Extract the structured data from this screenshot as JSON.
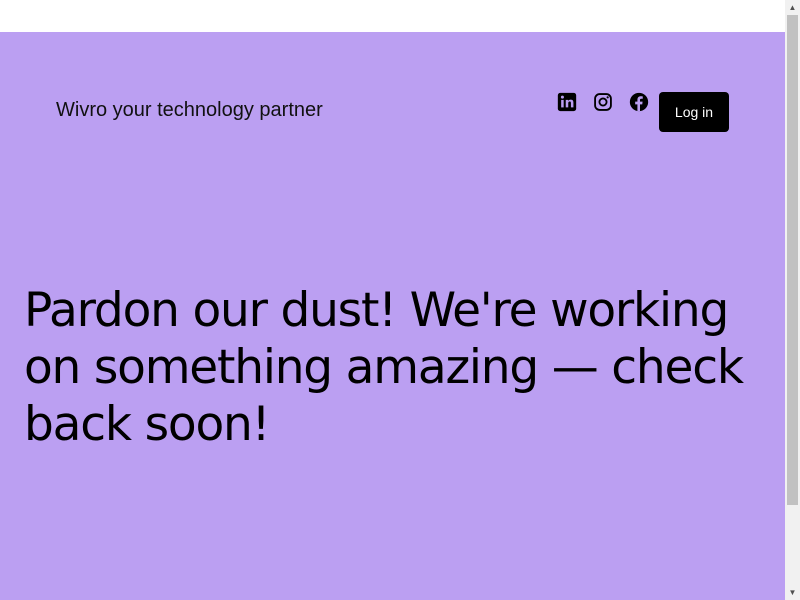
{
  "header": {
    "site_title": "Wivro your technology partner",
    "social_icons": [
      "linkedin-icon",
      "instagram-icon",
      "facebook-icon"
    ],
    "login_label": "Log in"
  },
  "hero": {
    "heading": "Pardon our dust! We're working on something amazing — check back soon!"
  },
  "colors": {
    "page_background": "#bb9ff2",
    "button_background": "#000000",
    "button_text": "#ffffff"
  }
}
